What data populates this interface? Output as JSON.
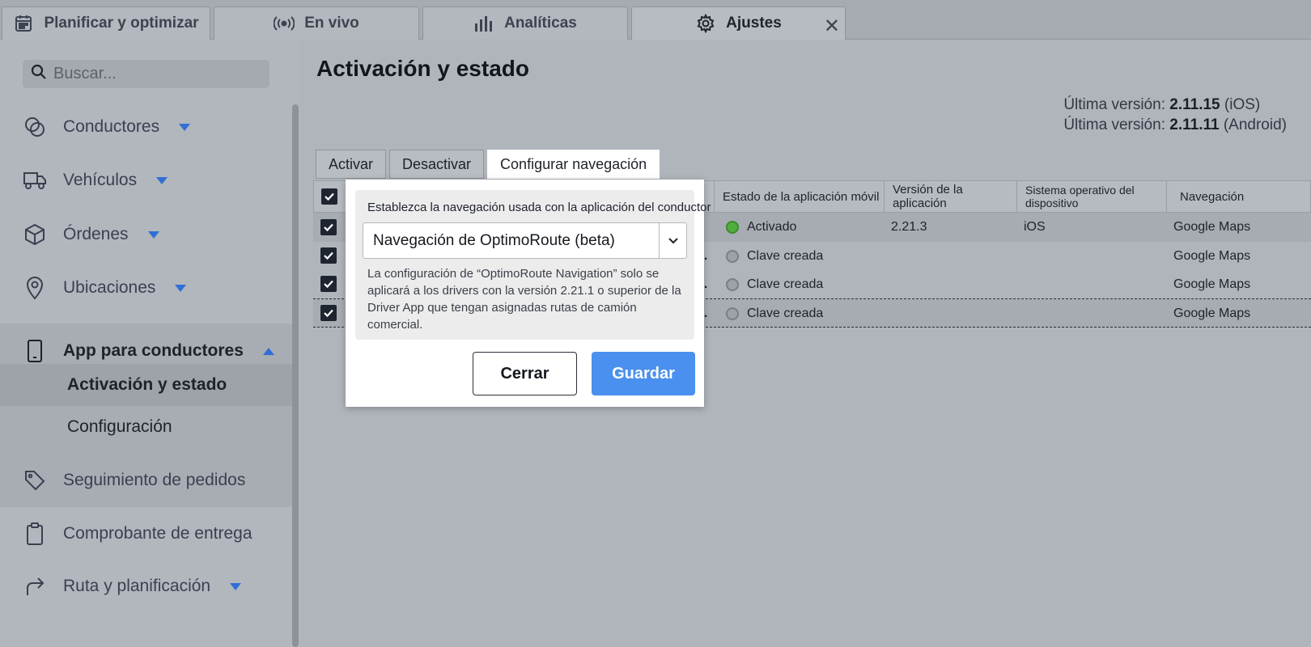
{
  "tabs": [
    {
      "label": "Planificar y optimizar",
      "icon": "calendar-icon"
    },
    {
      "label": "En vivo",
      "icon": "broadcast-icon"
    },
    {
      "label": "Analíticas",
      "icon": "bar-chart-icon"
    },
    {
      "label": "Ajustes",
      "icon": "gear-icon",
      "active": true
    }
  ],
  "sidebar": {
    "search_placeholder": "Buscar...",
    "items": [
      {
        "label": "Conductores",
        "icon": "drivers-icon"
      },
      {
        "label": "Vehículos",
        "icon": "truck-icon"
      },
      {
        "label": "Órdenes",
        "icon": "box-icon"
      },
      {
        "label": "Ubicaciones",
        "icon": "location-pin-icon"
      },
      {
        "label": "App para conductores",
        "icon": "phone-icon"
      },
      {
        "label": "Seguimiento de pedidos",
        "icon": "tag-icon"
      },
      {
        "label": "Comprobante de entrega",
        "icon": "clipboard-icon"
      },
      {
        "label": "Ruta y planificación",
        "icon": "route-arrow-icon"
      }
    ],
    "subitems": [
      "Activación y estado",
      "Configuración"
    ]
  },
  "main": {
    "title": "Activación y estado",
    "version_label": "Última versión:",
    "ios_version": "2.11.15",
    "ios_suffix": "(iOS)",
    "android_version": "2.11.11",
    "android_suffix": "(Android)",
    "actions": [
      "Activar",
      "Desactivar",
      "Configurar navegación"
    ],
    "table": {
      "columns": [
        "Estado de la aplicación móvil",
        "Versión de la aplicación",
        "Sistema operativo del dispositivo",
        "Navegación"
      ],
      "rows": [
        {
          "status": "Activado",
          "status_color": "green",
          "version": "2.21.3",
          "os": "iOS",
          "nav": "Google Maps",
          "truncated": ""
        },
        {
          "status": "Clave creada",
          "status_color": "grey",
          "version": "",
          "os": "",
          "nav": "Google Maps",
          "truncated": "..."
        },
        {
          "status": "Clave creada",
          "status_color": "grey",
          "version": "",
          "os": "",
          "nav": "Google Maps",
          "truncated": "..."
        },
        {
          "status": "Clave creada",
          "status_color": "grey",
          "version": "",
          "os": "",
          "nav": "Google Maps",
          "truncated": "..."
        }
      ]
    }
  },
  "modal": {
    "label": "Establezca la navegación usada con la aplicación del conductor",
    "selected": "Navegación de OptimoRoute (beta)",
    "note": "La configuración de “OptimoRoute Navigation” solo se aplicará a los drivers con la versión 2.21.1 o superior de la Driver App que tengan asignadas rutas de camión comercial.",
    "close_label": "Cerrar",
    "save_label": "Guardar"
  },
  "colors": {
    "accent": "#2f6fd6",
    "save_button": "#4a90ee",
    "status_active": "#4fae3c"
  }
}
